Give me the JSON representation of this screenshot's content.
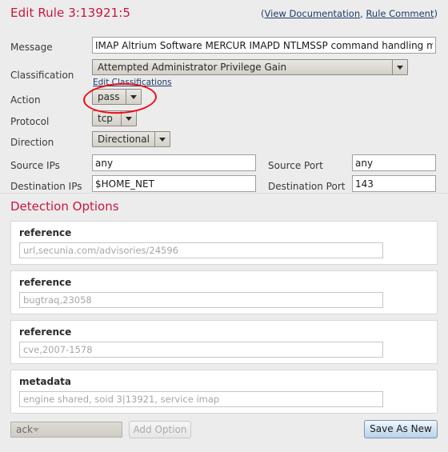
{
  "header": {
    "title": "Edit Rule 3:13921:5",
    "links": [
      {
        "label": "View Documentation",
        "name": "view-documentation-link"
      },
      {
        "label": "Rule Comment",
        "name": "rule-comment-link"
      }
    ],
    "open_paren": "(",
    "separator": ", ",
    "close_paren": ")"
  },
  "colors": {
    "title_red": "#c9173c",
    "link_navy": "#1d3c6e",
    "annotation_red": "#ee0d15",
    "page_bg": "#ececec",
    "panel_bg": "#ffffff"
  },
  "form": {
    "message": {
      "label": "Message",
      "value": "IMAP Altrium Software MERCUR IMAPD NTLMSSP command handling me"
    },
    "classification": {
      "label": "Classification",
      "value": "Attempted Administrator Privilege Gain",
      "edit_link": "Edit Classifications"
    },
    "action": {
      "label": "Action",
      "value": "pass"
    },
    "protocol": {
      "label": "Protocol",
      "value": "tcp"
    },
    "direction": {
      "label": "Direction",
      "value": "Directional"
    },
    "source_ips": {
      "label": "Source IPs",
      "value": "any"
    },
    "destination_ips": {
      "label": "Destination IPs",
      "value": "$HOME_NET"
    },
    "source_port": {
      "label": "Source Port",
      "value": "any"
    },
    "destination_port": {
      "label": "Destination Port",
      "value": "143"
    }
  },
  "detection": {
    "section_title": "Detection Options",
    "options": [
      {
        "title": "reference",
        "value": "url,secunia.com/advisories/24596"
      },
      {
        "title": "reference",
        "value": "bugtraq,23058"
      },
      {
        "title": "reference",
        "value": "cve,2007-1578"
      },
      {
        "title": "metadata",
        "value": "engine shared, soid 3|13921, service imap"
      }
    ]
  },
  "footer": {
    "option_select_value": "ack",
    "add_option_label": "Add Option",
    "save_label": "Save As New"
  }
}
